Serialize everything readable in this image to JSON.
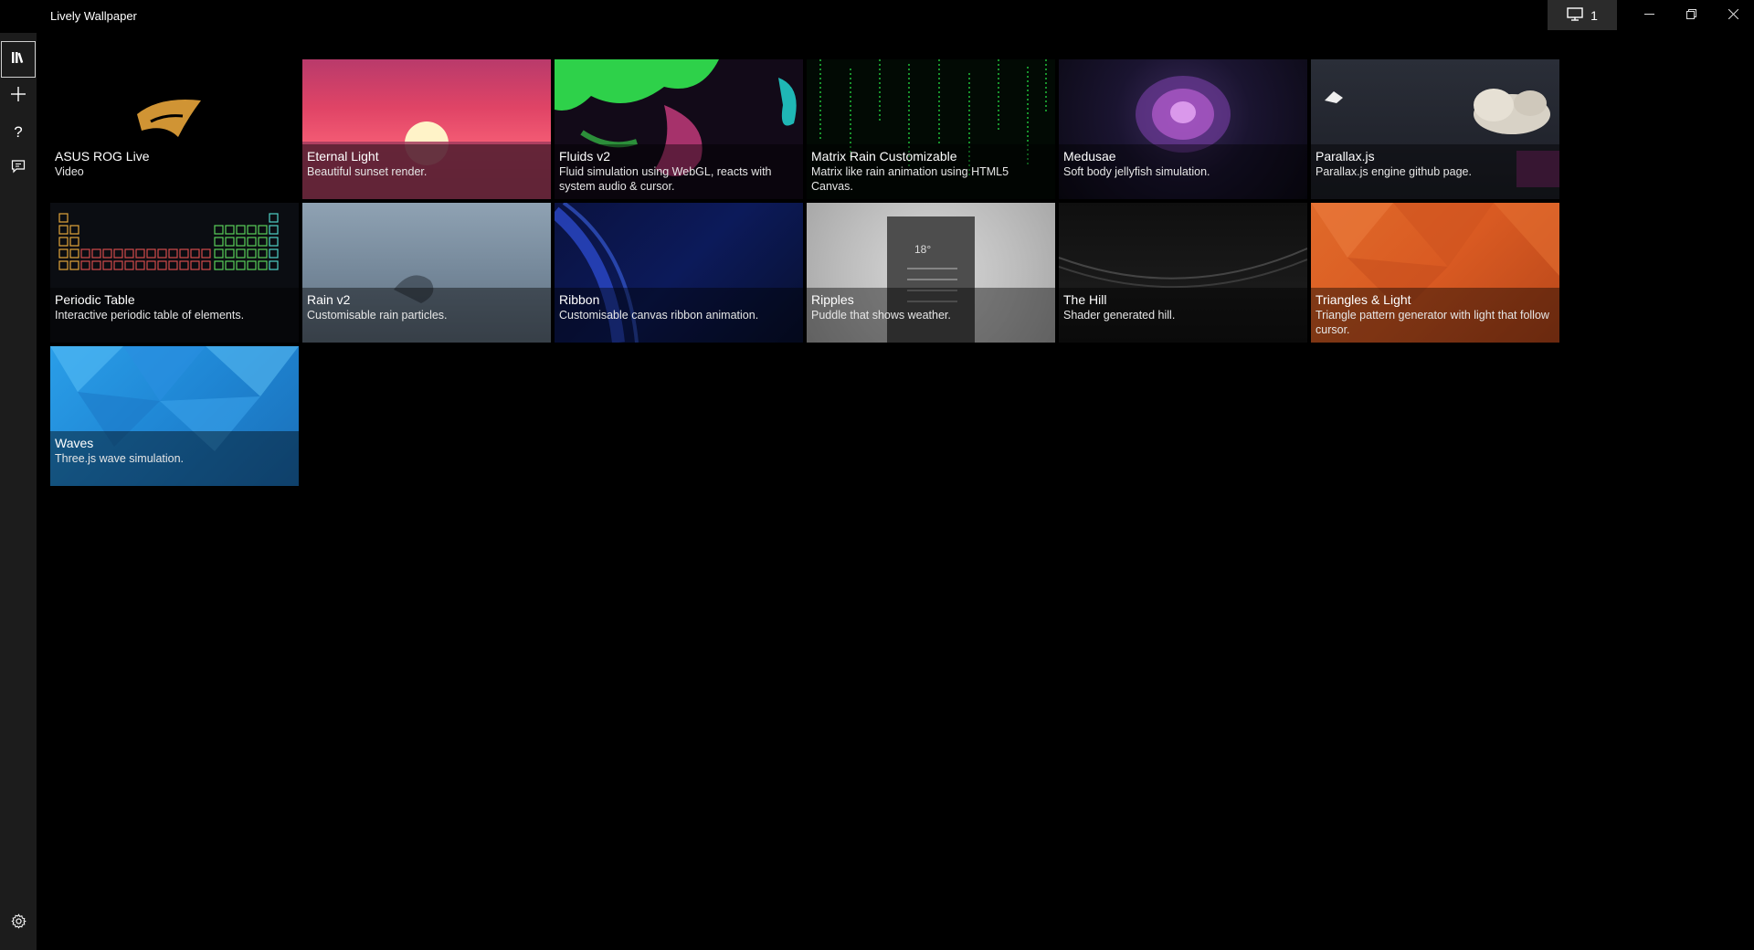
{
  "app": {
    "title": "Lively Wallpaper"
  },
  "titlebar": {
    "monitor_count": "1",
    "minimize_icon": "minimize-icon",
    "maximize_icon": "restore-icon",
    "close_icon": "close-icon"
  },
  "sidebar": {
    "items": [
      {
        "icon": "library-icon",
        "selected": true
      },
      {
        "icon": "add-icon"
      },
      {
        "icon": "help-icon"
      },
      {
        "icon": "feedback-icon"
      }
    ],
    "settings_icon": "gear-icon"
  },
  "library": {
    "selected_index": 0,
    "items": [
      {
        "title": "ASUS ROG Live",
        "desc": "Video"
      },
      {
        "title": "Eternal Light",
        "desc": "Beautiful sunset render."
      },
      {
        "title": "Fluids v2",
        "desc": "Fluid simulation using WebGL, reacts with system audio & cursor."
      },
      {
        "title": "Matrix Rain Customizable",
        "desc": "Matrix like rain animation using HTML5 Canvas."
      },
      {
        "title": "Medusae",
        "desc": "Soft body jellyfish simulation."
      },
      {
        "title": "Parallax.js",
        "desc": "Parallax.js engine github page."
      },
      {
        "title": "Periodic Table",
        "desc": "Interactive periodic table of elements."
      },
      {
        "title": "Rain v2",
        "desc": "Customisable rain particles."
      },
      {
        "title": "Ribbon",
        "desc": "Customisable canvas ribbon animation."
      },
      {
        "title": "Ripples",
        "desc": "Puddle that shows weather."
      },
      {
        "title": "The Hill",
        "desc": "Shader generated hill."
      },
      {
        "title": "Triangles & Light",
        "desc": "Triangle pattern generator with light that follow cursor."
      },
      {
        "title": "Waves",
        "desc": "Three.js wave simulation."
      }
    ]
  },
  "colors": {
    "selection": "#2e6fd3",
    "sidebar": "#1c1c1c",
    "background": "#000000"
  }
}
